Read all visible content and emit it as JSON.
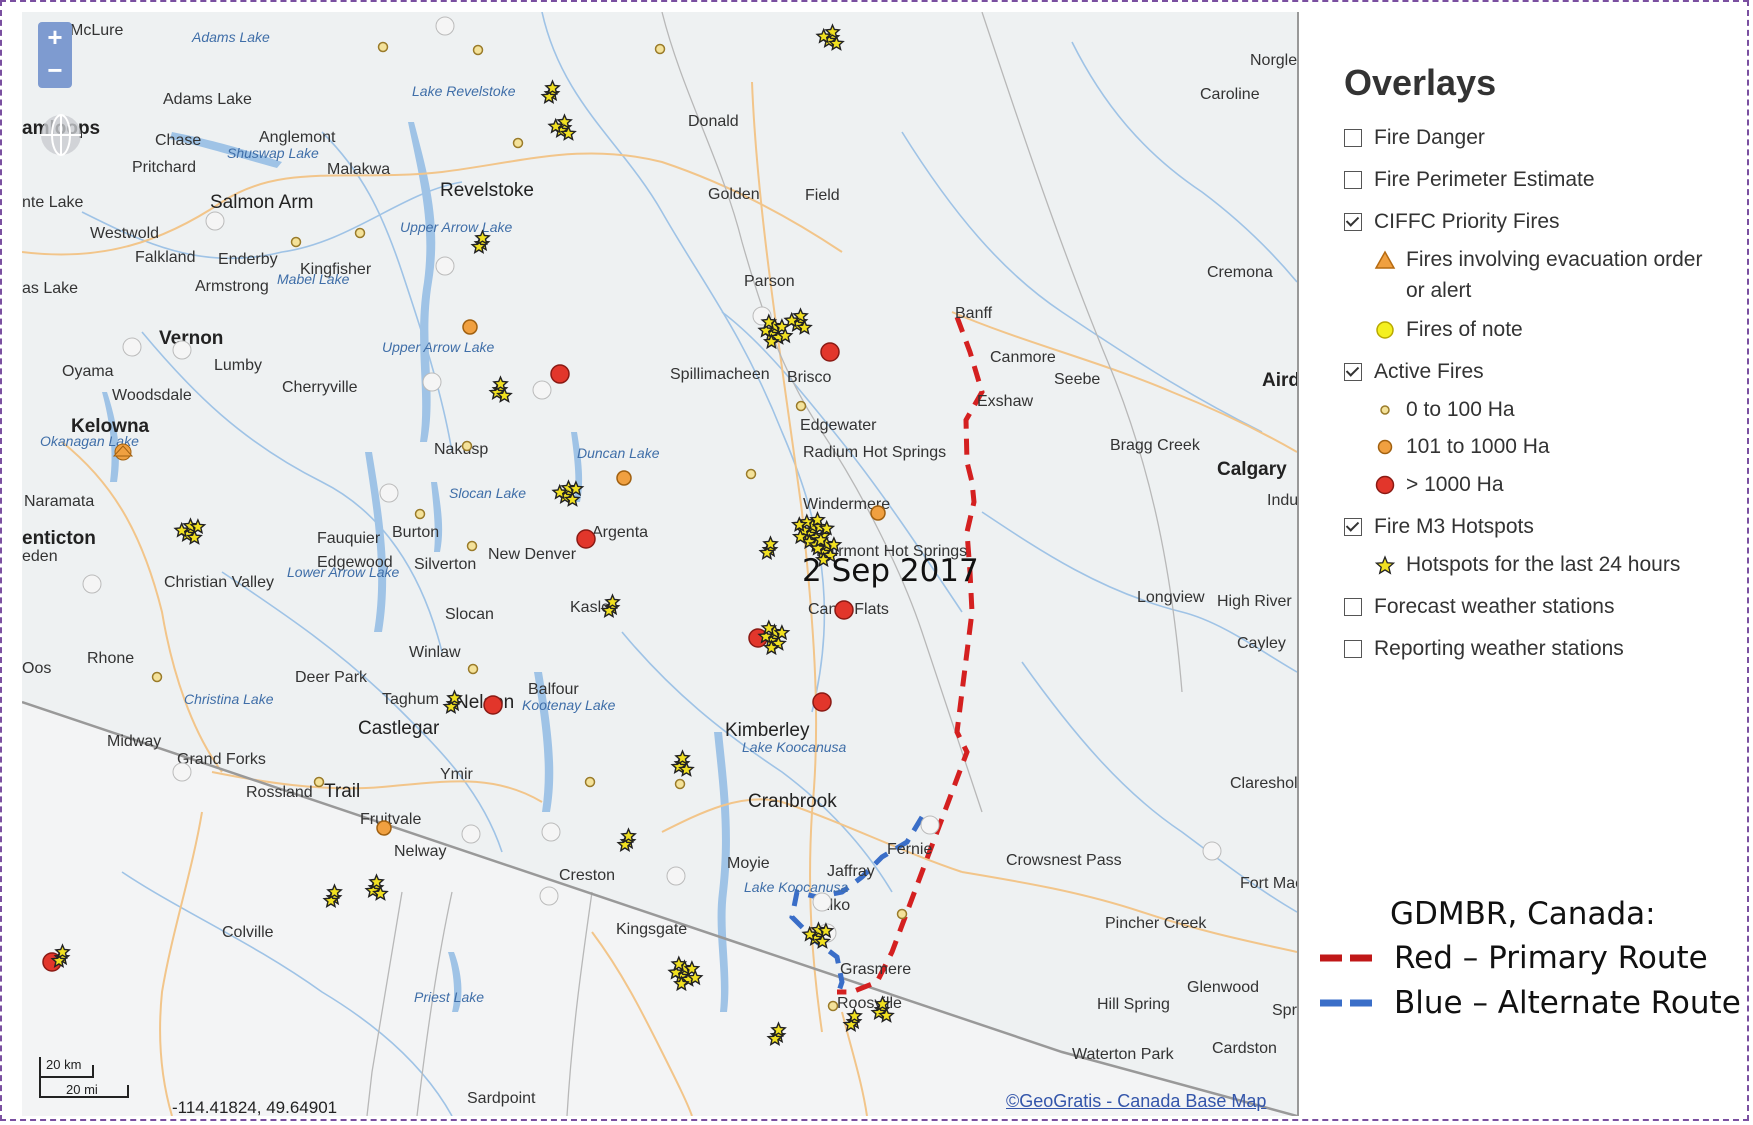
{
  "map": {
    "zoom_in": "+",
    "zoom_out": "−",
    "date_label": "2 Sep 2017",
    "coordinates": "-114.41824, 49.64901",
    "credit": "©GeoGratis - Canada Base Map",
    "scale_km": "20 km",
    "scale_mi": "20 mi",
    "colors": {
      "land": "#eef1f2",
      "water": "#9fc3e6",
      "red_route": "#d42020",
      "blue_route": "#3a6ec8",
      "fire_red": "#e2362b",
      "fire_orange": "#f0a040"
    }
  },
  "places": [
    "McLure",
    "Adams Lake",
    "amloops",
    "Chase",
    "Anglemont",
    "Pritchard",
    "Salmon Arm",
    "Malakwa",
    "Revelstoke",
    "Westwold",
    "Falkland",
    "Enderby",
    "Kingfisher",
    "Armstrong",
    "Vernon",
    "Oyama",
    "Lumby",
    "Cherryville",
    "Woodsdale",
    "Kelowna",
    "Naramata",
    "enticton",
    "Nakusp",
    "Fauquier",
    "Burton",
    "Edgewood",
    "Silverton",
    "New Denver",
    "Argenta",
    "Kaslo",
    "Christian Valley",
    "Slocan",
    "Winlaw",
    "Rhone",
    "Deer Park",
    "Taghum",
    "Nelson",
    "Balfour",
    "Castlegar",
    "Midway",
    "Grand Forks",
    "Ymir",
    "Rossland",
    "Trail",
    "Fruitvale",
    "Nelway",
    "Creston",
    "Colville",
    "Kingsgate",
    "Donald",
    "Golden",
    "Field",
    "Parson",
    "Spillimacheen",
    "Brisco",
    "Edgewater",
    "Radium Hot Springs",
    "Windermere",
    "Fairmont Hot Springs",
    "Canal Flats",
    "Kimberley",
    "Cranbrook",
    "Moyie",
    "Jaffray",
    "Fernie",
    "Elko",
    "Grasmere",
    "Roosville",
    "Banff",
    "Canmore",
    "Exshaw",
    "Seebe",
    "Bragg Creek",
    "Calgary",
    "Longview",
    "High River",
    "Cayley",
    "Crowsnest Pass",
    "Claresholm",
    "Pincher Creek",
    "Fort Macleod",
    "Glenwood",
    "Hill Spring",
    "Waterton Park",
    "Cardston",
    "Carolinе",
    "Cremona",
    "Norglenwold",
    "Airdrie",
    "Sardpoint",
    "eden",
    "Oos",
    "as Lake",
    "nte Lake",
    "Indus",
    "Spr"
  ],
  "lakes": [
    "Adams Lake",
    "Lake Revelstoke",
    "Shuswap Lake",
    "Upper Arrow Lake",
    "Mabel Lake",
    "Upper Arrow Lake",
    "Okanagan Lake",
    "Duncan Lake",
    "Slocan Lake",
    "Lower Arrow Lake",
    "Kootenay Lake",
    "Christina Lake",
    "Lake Koocanusa",
    "Lake Koocanusa",
    "Priest Lake"
  ],
  "overlays": {
    "title": "Overlays",
    "items": [
      {
        "label": "Fire Danger",
        "checked": false
      },
      {
        "label": "Fire Perimeter Estimate",
        "checked": false
      },
      {
        "label": "CIFFC Priority Fires",
        "checked": true
      },
      {
        "label": "Fires involving evacuation order",
        "sub": true,
        "symbol": "orange-triangle-icon"
      },
      {
        "label": "or alert",
        "sub": true
      },
      {
        "label": "Fires of note",
        "sub": true,
        "symbol": "yellow-circle-icon"
      },
      {
        "label": "Active Fires",
        "checked": true
      },
      {
        "label": "0 to 100 Ha",
        "sub": true,
        "symbol": "small-circle-icon"
      },
      {
        "label": "101 to 1000 Ha",
        "sub": true,
        "symbol": "orange-circle-icon"
      },
      {
        "label": "> 1000 Ha",
        "sub": true,
        "symbol": "red-circle-icon"
      },
      {
        "label": "Fire M3 Hotspots",
        "checked": true
      },
      {
        "label": "Hotspots for the last 24 hours",
        "sub": true,
        "symbol": "star-icon"
      },
      {
        "label": "Forecast weather stations",
        "checked": false
      },
      {
        "label": "Reporting weather stations",
        "checked": false
      }
    ]
  },
  "legend": {
    "title": "GDMBR, Canada:",
    "red": "Red – Primary Route",
    "blue": "Blue – Alternate Route"
  }
}
